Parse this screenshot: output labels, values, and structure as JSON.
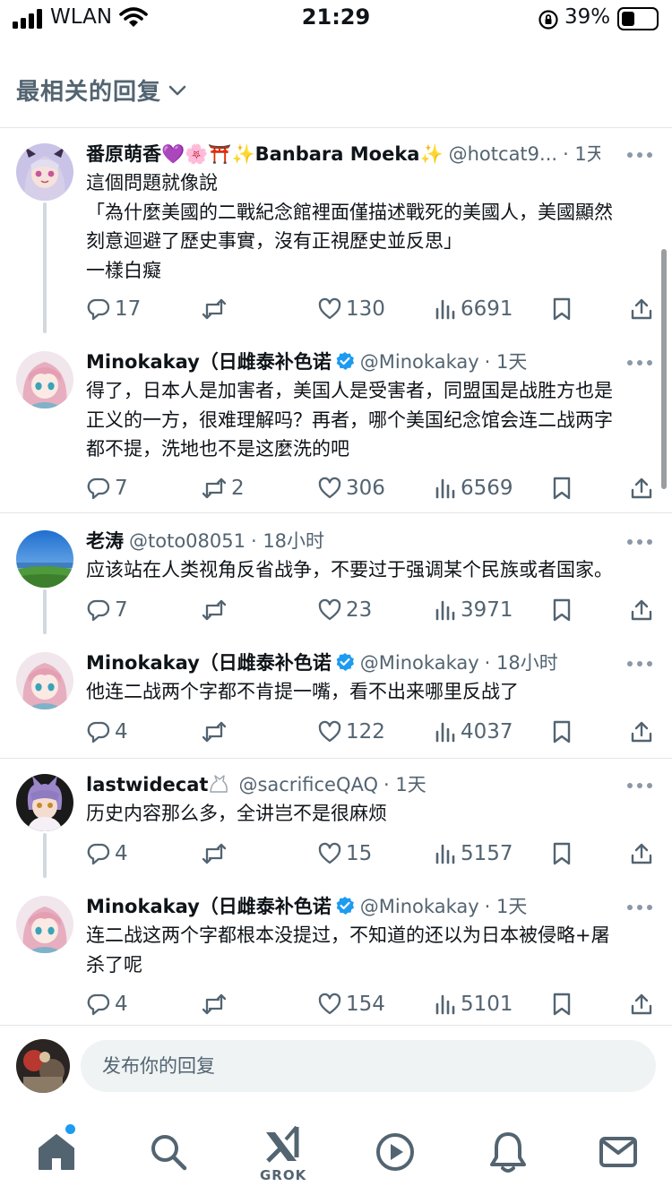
{
  "status_bar": {
    "carrier": "WLAN",
    "time": "21:29",
    "battery": "39%"
  },
  "header": {
    "sort_label": "最相关的回复"
  },
  "posts": [
    {
      "name": "番原萌香💜🌸⛩️✨Banbara Moeka✨",
      "handle": "@hotcat9...",
      "time": "· 1天",
      "lines": [
        "這個問題就像說",
        "「為什麼美國的二戰紀念館裡面僅描述戰死的美國人，美國顯然",
        "刻意迴避了歷史事實，沒有正視歷史並反思」",
        "一樣白癡"
      ],
      "replies": "17",
      "reposts": "",
      "likes": "130",
      "views": "6691"
    },
    {
      "name": "Minokakay（日雌泰补色诺",
      "handle": "@Minokakay",
      "time": "· 1天",
      "lines": [
        "得了，日本人是加害者，美国人是受害者，同盟国是战胜方也是",
        "正义的一方，很难理解吗？再者，哪个美国纪念馆会连二战两字",
        "都不提，洗地也不是这麼洗的吧"
      ],
      "replies": "7",
      "reposts": "2",
      "likes": "306",
      "views": "6569"
    },
    {
      "name": "老涛",
      "handle": "@toto08051",
      "time": "· 18小时",
      "lines": [
        "应该站在人类视角反省战争，不要过于强调某个民族或者国家。"
      ],
      "replies": "7",
      "reposts": "",
      "likes": "23",
      "views": "3971"
    },
    {
      "name": "Minokakay（日雌泰补色诺",
      "handle": "@Minokakay",
      "time": "· 18小时",
      "lines": [
        "他连二战两个字都不肯提一嘴，看不出来哪里反战了"
      ],
      "replies": "4",
      "reposts": "",
      "likes": "122",
      "views": "4037"
    },
    {
      "name": "lastwidecat",
      "handle": "@sacrificeQAQ",
      "time": "· 1天",
      "lines": [
        "历史内容那么多，全讲岂不是很麻烦"
      ],
      "replies": "4",
      "reposts": "",
      "likes": "15",
      "views": "5157"
    },
    {
      "name": "Minokakay（日雌泰补色诺",
      "handle": "@Minokakay",
      "time": "· 1天",
      "lines": [
        "连二战这两个字都根本没提过，不知道的还以为日本被侵略+屠",
        "杀了呢"
      ],
      "replies": "4",
      "reposts": "",
      "likes": "154",
      "views": "5101"
    }
  ],
  "compose": {
    "placeholder": "发布你的回复"
  },
  "tabbar": {
    "grok_label": "GROK"
  },
  "colors": {
    "accent": "#1d9bf0",
    "secondary_text": "#536471",
    "verified": "#1d9bf0",
    "divider": "#e1e6ea"
  },
  "icons": [
    "signal-icon",
    "wifi-icon",
    "orientation-lock-icon",
    "battery-icon",
    "chevron-down-icon",
    "reply-icon",
    "repost-icon",
    "like-icon",
    "views-icon",
    "bookmark-icon",
    "share-icon",
    "more-icon",
    "verified-badge-icon",
    "home-icon",
    "search-icon",
    "grok-icon",
    "video-icon",
    "notifications-icon",
    "messages-icon"
  ]
}
